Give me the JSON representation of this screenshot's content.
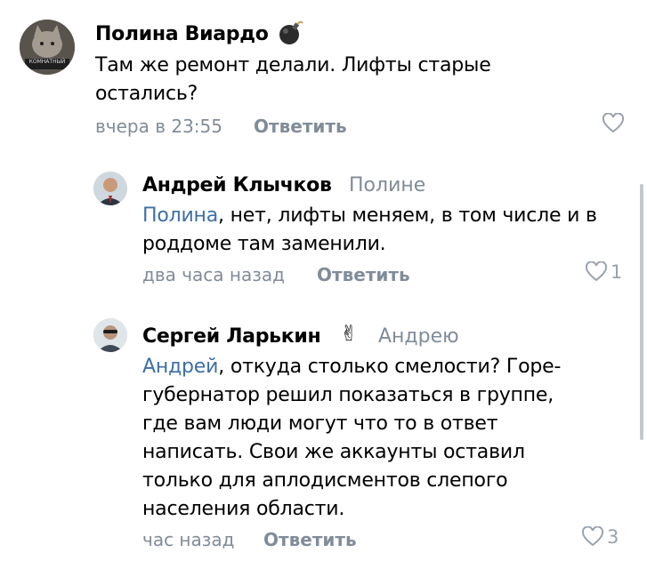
{
  "comments": [
    {
      "author": "Полина Виардо",
      "reply_to": "",
      "avatar_caption": "КОМНАТНЫЙ",
      "badge_icon": "bomb-icon",
      "mention": "",
      "text": "Там же ремонт делали. Лифты старые остались?",
      "time": "вчера в 23:55",
      "reply_label": "Ответить",
      "likes": ""
    },
    {
      "author": "Андрей Клычков",
      "reply_to": "Полине",
      "badge_icon": "",
      "mention": "Полина",
      "text": ", нет, лифты меняем, в том числе и в роддоме там заменили.",
      "time": "два часа назад",
      "reply_label": "Ответить",
      "likes": "1"
    },
    {
      "author": "Сергей Ларькин",
      "reply_to": "Андрею",
      "badge_icon": "victory-hand-icon",
      "mention": "Андрей",
      "text": ", откуда столько смелости? Горе-губернатор решил показаться в группе, где вам люди могут что то в ответ написать. Свои же аккаунты оставил только для аплодисментов слепого населения области.",
      "time": "час назад",
      "reply_label": "Ответить",
      "likes": "3"
    }
  ],
  "colors": {
    "secondary": "#818c99",
    "mention": "#3d6fa8",
    "like_icon": "#99a2ad"
  }
}
